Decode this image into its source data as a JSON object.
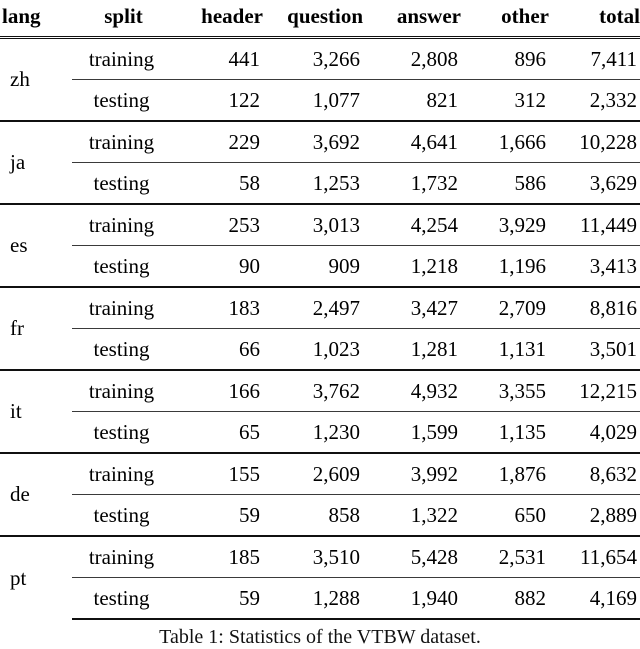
{
  "table": {
    "columns": [
      "lang",
      "split",
      "header",
      "question",
      "answer",
      "other",
      "total"
    ],
    "groups": [
      {
        "lang": "zh",
        "rows": [
          {
            "split": "training",
            "header": "441",
            "question": "3,266",
            "answer": "2,808",
            "other": "896",
            "total": "7,411"
          },
          {
            "split": "testing",
            "header": "122",
            "question": "1,077",
            "answer": "821",
            "other": "312",
            "total": "2,332"
          }
        ]
      },
      {
        "lang": "ja",
        "rows": [
          {
            "split": "training",
            "header": "229",
            "question": "3,692",
            "answer": "4,641",
            "other": "1,666",
            "total": "10,228"
          },
          {
            "split": "testing",
            "header": "58",
            "question": "1,253",
            "answer": "1,732",
            "other": "586",
            "total": "3,629"
          }
        ]
      },
      {
        "lang": "es",
        "rows": [
          {
            "split": "training",
            "header": "253",
            "question": "3,013",
            "answer": "4,254",
            "other": "3,929",
            "total": "11,449"
          },
          {
            "split": "testing",
            "header": "90",
            "question": "909",
            "answer": "1,218",
            "other": "1,196",
            "total": "3,413"
          }
        ]
      },
      {
        "lang": "fr",
        "rows": [
          {
            "split": "training",
            "header": "183",
            "question": "2,497",
            "answer": "3,427",
            "other": "2,709",
            "total": "8,816"
          },
          {
            "split": "testing",
            "header": "66",
            "question": "1,023",
            "answer": "1,281",
            "other": "1,131",
            "total": "3,501"
          }
        ]
      },
      {
        "lang": "it",
        "rows": [
          {
            "split": "training",
            "header": "166",
            "question": "3,762",
            "answer": "4,932",
            "other": "3,355",
            "total": "12,215"
          },
          {
            "split": "testing",
            "header": "65",
            "question": "1,230",
            "answer": "1,599",
            "other": "1,135",
            "total": "4,029"
          }
        ]
      },
      {
        "lang": "de",
        "rows": [
          {
            "split": "training",
            "header": "155",
            "question": "2,609",
            "answer": "3,992",
            "other": "1,876",
            "total": "8,632"
          },
          {
            "split": "testing",
            "header": "59",
            "question": "858",
            "answer": "1,322",
            "other": "650",
            "total": "2,889"
          }
        ]
      },
      {
        "lang": "pt",
        "rows": [
          {
            "split": "training",
            "header": "185",
            "question": "3,510",
            "answer": "5,428",
            "other": "2,531",
            "total": "11,654"
          },
          {
            "split": "testing",
            "header": "59",
            "question": "1,288",
            "answer": "1,940",
            "other": "882",
            "total": "4,169"
          }
        ]
      }
    ]
  },
  "caption": {
    "text": "Table 1: Statistics of the VTBW dataset."
  }
}
